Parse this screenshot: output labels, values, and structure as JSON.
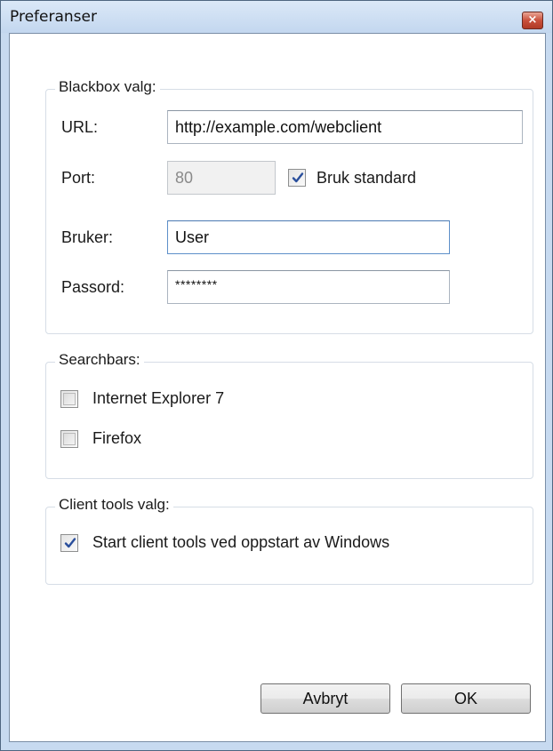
{
  "window": {
    "title": "Preferanser",
    "close_glyph": "×"
  },
  "blackbox": {
    "legend": "Blackbox valg:",
    "url_label": "URL:",
    "url_value": "http://example.com/webclient",
    "port_label": "Port:",
    "port_value": "80",
    "use_default_label": "Bruk standard",
    "use_default_checked": true,
    "user_label": "Bruker:",
    "user_value": "User",
    "password_label": "Passord:",
    "password_value": "********"
  },
  "searchbars": {
    "legend": "Searchbars:",
    "items": [
      {
        "label": "Internet Explorer 7",
        "checked": false
      },
      {
        "label": "Firefox",
        "checked": false
      }
    ]
  },
  "client_tools": {
    "legend": "Client tools valg:",
    "startup_label": "Start client tools ved oppstart av Windows",
    "startup_checked": true
  },
  "buttons": {
    "cancel_label": "Avbryt",
    "ok_label": "OK"
  },
  "colors": {
    "title_bar": "#c7daf0",
    "close_button": "#c9503c",
    "check_mark": "#2a4f9c"
  }
}
